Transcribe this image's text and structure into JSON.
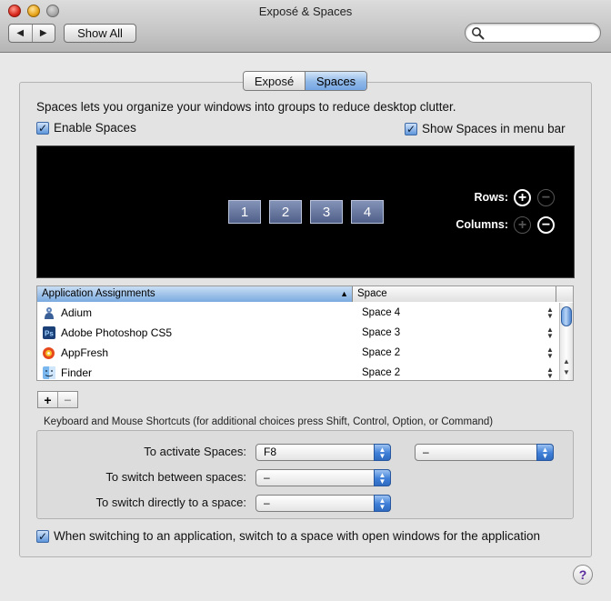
{
  "window": {
    "title": "Exposé & Spaces"
  },
  "toolbar": {
    "back_glyph": "◀",
    "forward_glyph": "▶",
    "show_all_label": "Show All",
    "search_placeholder": ""
  },
  "tabs": [
    {
      "label": "Exposé",
      "selected": false
    },
    {
      "label": "Spaces",
      "selected": true
    }
  ],
  "description": "Spaces lets you organize your windows into groups to reduce desktop clutter.",
  "checkboxes": {
    "enable_spaces": {
      "label": "Enable Spaces",
      "checked": true,
      "mark": "✓"
    },
    "show_in_menu_bar": {
      "label": "Show Spaces in menu bar",
      "checked": true,
      "mark": "✓"
    },
    "switch_to_space": {
      "label": "When switching to an application, switch to a space with open windows for the application",
      "checked": true,
      "mark": "✓"
    }
  },
  "preview": {
    "spaces": [
      "1",
      "2",
      "3",
      "4"
    ],
    "rows_label": "Rows:",
    "columns_label": "Columns:",
    "plus_glyph": "+",
    "minus_glyph": "−"
  },
  "assignments": {
    "columns": {
      "app": "Application Assignments",
      "space": "Space"
    },
    "sort_glyph": "▲",
    "rows": [
      {
        "app": "Adium",
        "space": "Space 4",
        "icon": "adium-icon"
      },
      {
        "app": "Adobe Photoshop CS5",
        "space": "Space 3",
        "icon": "photoshop-icon"
      },
      {
        "app": "AppFresh",
        "space": "Space 2",
        "icon": "appfresh-icon"
      },
      {
        "app": "Finder",
        "space": "Space 2",
        "icon": "finder-icon"
      }
    ],
    "add_glyph": "+",
    "remove_glyph": "−"
  },
  "shortcuts": {
    "heading": "Keyboard and Mouse Shortcuts (for additional choices press Shift, Control, Option, or Command)",
    "activate": {
      "label": "To activate Spaces:",
      "key": "F8",
      "mouse": "–"
    },
    "switch_between": {
      "label": "To switch between spaces:",
      "value": "–"
    },
    "switch_directly": {
      "label": "To switch directly to a space:",
      "value": "–"
    }
  },
  "help_glyph": "?",
  "colors": {
    "selection_blue": "#7aaae0",
    "preview_bg": "#000000",
    "tile": "#6576a0"
  }
}
